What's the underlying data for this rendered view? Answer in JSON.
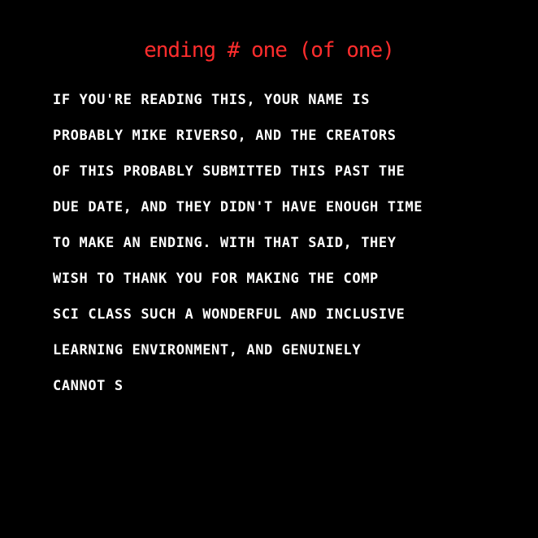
{
  "title": "ending # one (of one)",
  "colors": {
    "background": "#000000",
    "title": "#ff2d2d",
    "text": "#ffffff"
  },
  "story_lines": [
    "IF YOU'RE READING THIS, YOUR NAME IS",
    "PROBABLY MIKE RIVERSO, AND THE CREATORS",
    "OF THIS PROBABLY SUBMITTED THIS PAST THE",
    "DUE DATE, AND THEY DIDN'T HAVE ENOUGH TIME",
    "TO MAKE AN ENDING. WITH THAT SAID, THEY",
    "WISH TO THANK YOU FOR MAKING THE COMP",
    "SCI CLASS SUCH A WONDERFUL AND INCLUSIVE",
    "LEARNING ENVIRONMENT, AND GENUINELY",
    "CANNOT S"
  ]
}
